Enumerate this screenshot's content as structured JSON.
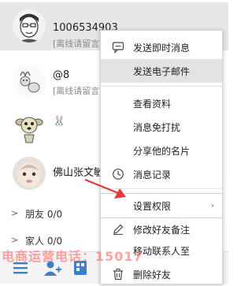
{
  "contacts": [
    {
      "name": "1006534903",
      "status": "[离线请留言]",
      "avatar": "sketch-boy-avatar"
    },
    {
      "name": "@8",
      "status": "[离线请留言]",
      "avatar": "rabbit-doodle-avatar"
    },
    {
      "name": "🐰",
      "status": "",
      "avatar": "cartoon-dog-avatar"
    },
    {
      "name": "佛山张文敏",
      "status": "",
      "avatar": "baby-photo-avatar"
    }
  ],
  "groups": [
    {
      "label": "朋友 0/0"
    },
    {
      "label": "家人 0/0"
    }
  ],
  "menu": {
    "items": [
      {
        "label": "发送即时消息",
        "icon": "chat-icon"
      },
      {
        "label": "发送电子邮件",
        "icon": ""
      },
      {
        "label": "查看资料",
        "icon": ""
      },
      {
        "label": "消息免打扰",
        "icon": ""
      },
      {
        "label": "分享他的名片",
        "icon": ""
      },
      {
        "label": "消息记录",
        "icon": "clock-icon"
      },
      {
        "label": "设置权限",
        "icon": "",
        "submenu": "›"
      },
      {
        "label": "修改好友备注",
        "icon": "pencil-icon"
      },
      {
        "label": "移动联系人至",
        "icon": ""
      },
      {
        "label": "删除好友",
        "icon": "trash-icon"
      }
    ]
  },
  "bottombar": {
    "icons": [
      "menu-icon",
      "add-contact-icon",
      "app-icon"
    ]
  },
  "watermark": {
    "text": "电商运营电话：15017"
  },
  "colors": {
    "arrow": "#e03c3c",
    "watermark": "#ff5a5a",
    "selected_row": "#e6e6e6",
    "menu_hover": "#e3e3e3"
  }
}
